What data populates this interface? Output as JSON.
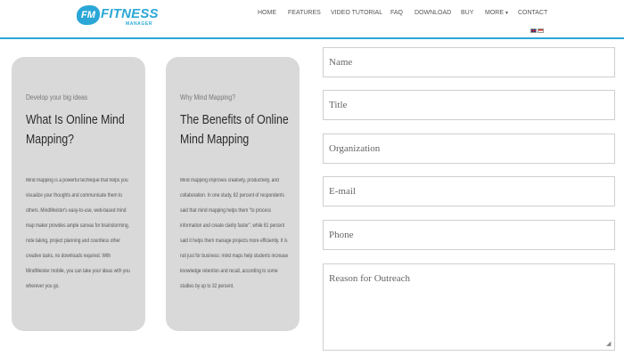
{
  "brand": {
    "badge": "FM",
    "word": "FITNESS",
    "sub": "MANAGER",
    "color": "#2aa7d6"
  },
  "nav": {
    "items": [
      {
        "label": "HOME"
      },
      {
        "label": "FEATURES"
      },
      {
        "label": "VIDEO TUTORIAL"
      },
      {
        "label": "FAQ"
      },
      {
        "label": "DOWNLOAD"
      },
      {
        "label": "BUY"
      },
      {
        "label": "MORE"
      },
      {
        "label": "CONTACT"
      }
    ],
    "flags": [
      "flag-uk-icon",
      "flag-alt-icon"
    ]
  },
  "cards": [
    {
      "eyebrow": "Develop your big ideas",
      "title": "What Is Online Mind Mapping?",
      "body": "Mind mapping is a powerful technique that helps you visualize your thoughts and communicate them to others. MindMeister's easy-to-use, web-based mind map maker provides ample canvas for brainstorming, note taking, project planning and countless other creative tasks, no downloads required. With MindMeister mobile, you can take your ideas with you wherever you go."
    },
    {
      "eyebrow": "Why Mind Mapping?",
      "title": "The Benefits of Online Mind Mapping",
      "body": "Mind mapping improves creativity, productivity, and collaboration. In one study, 82 percent of respondents said that mind mapping helps them \"to process information and create clarity faster\", while 81 percent said it helps them manage projects more efficiently. It is not just for business: mind maps help students increase knowledge retention and recall, according to some studies by up to 32 percent."
    }
  ],
  "form": {
    "name_placeholder": "Name",
    "title_placeholder": "Title",
    "organization_placeholder": "Organization",
    "email_placeholder": "E-mail",
    "phone_placeholder": "Phone",
    "reason_placeholder": "Reason for Outreach"
  }
}
